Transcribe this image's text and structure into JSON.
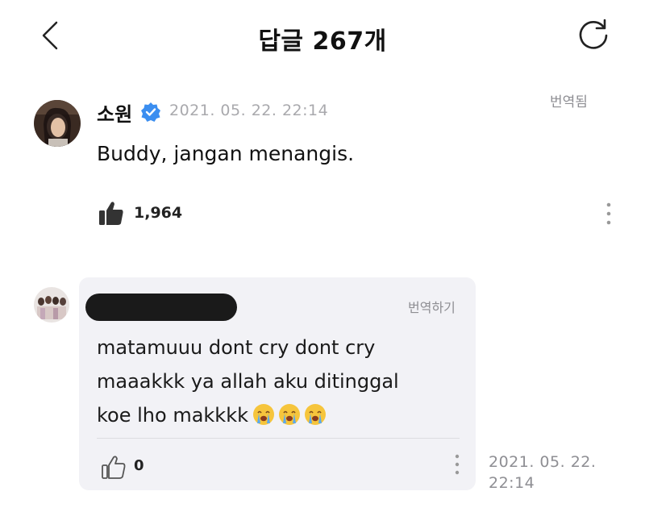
{
  "header": {
    "title": "답글 267개",
    "back_icon": "chevron-left-icon",
    "refresh_icon": "refresh-icon"
  },
  "comment": {
    "author": "소원",
    "verified_icon": "verified-badge-icon",
    "timestamp": "2021. 05. 22. 22:14",
    "translated_label": "번역됨",
    "text": "Buddy, jangan menangis.",
    "like_icon": "thumbs-up-icon",
    "like_count": "1,964",
    "more_icon": "more-vertical-icon"
  },
  "reply": {
    "author": "",
    "translate_label": "번역하기",
    "text_line1": "matamuuu dont cry dont cry",
    "text_line2": "maaakkk ya allah aku ditinggal",
    "text_line3": "koe lho makkkk",
    "emoji": "loudly-crying-face",
    "like_icon": "thumbs-up-outline-icon",
    "like_count": "0",
    "more_icon": "more-vertical-icon",
    "timestamp_line1": "2021. 05. 22.",
    "timestamp_line2": "22:14"
  },
  "colors": {
    "verified_blue": "#3b8ef0",
    "bubble_bg": "#f2f2f6",
    "muted_text": "#8e8e93"
  }
}
